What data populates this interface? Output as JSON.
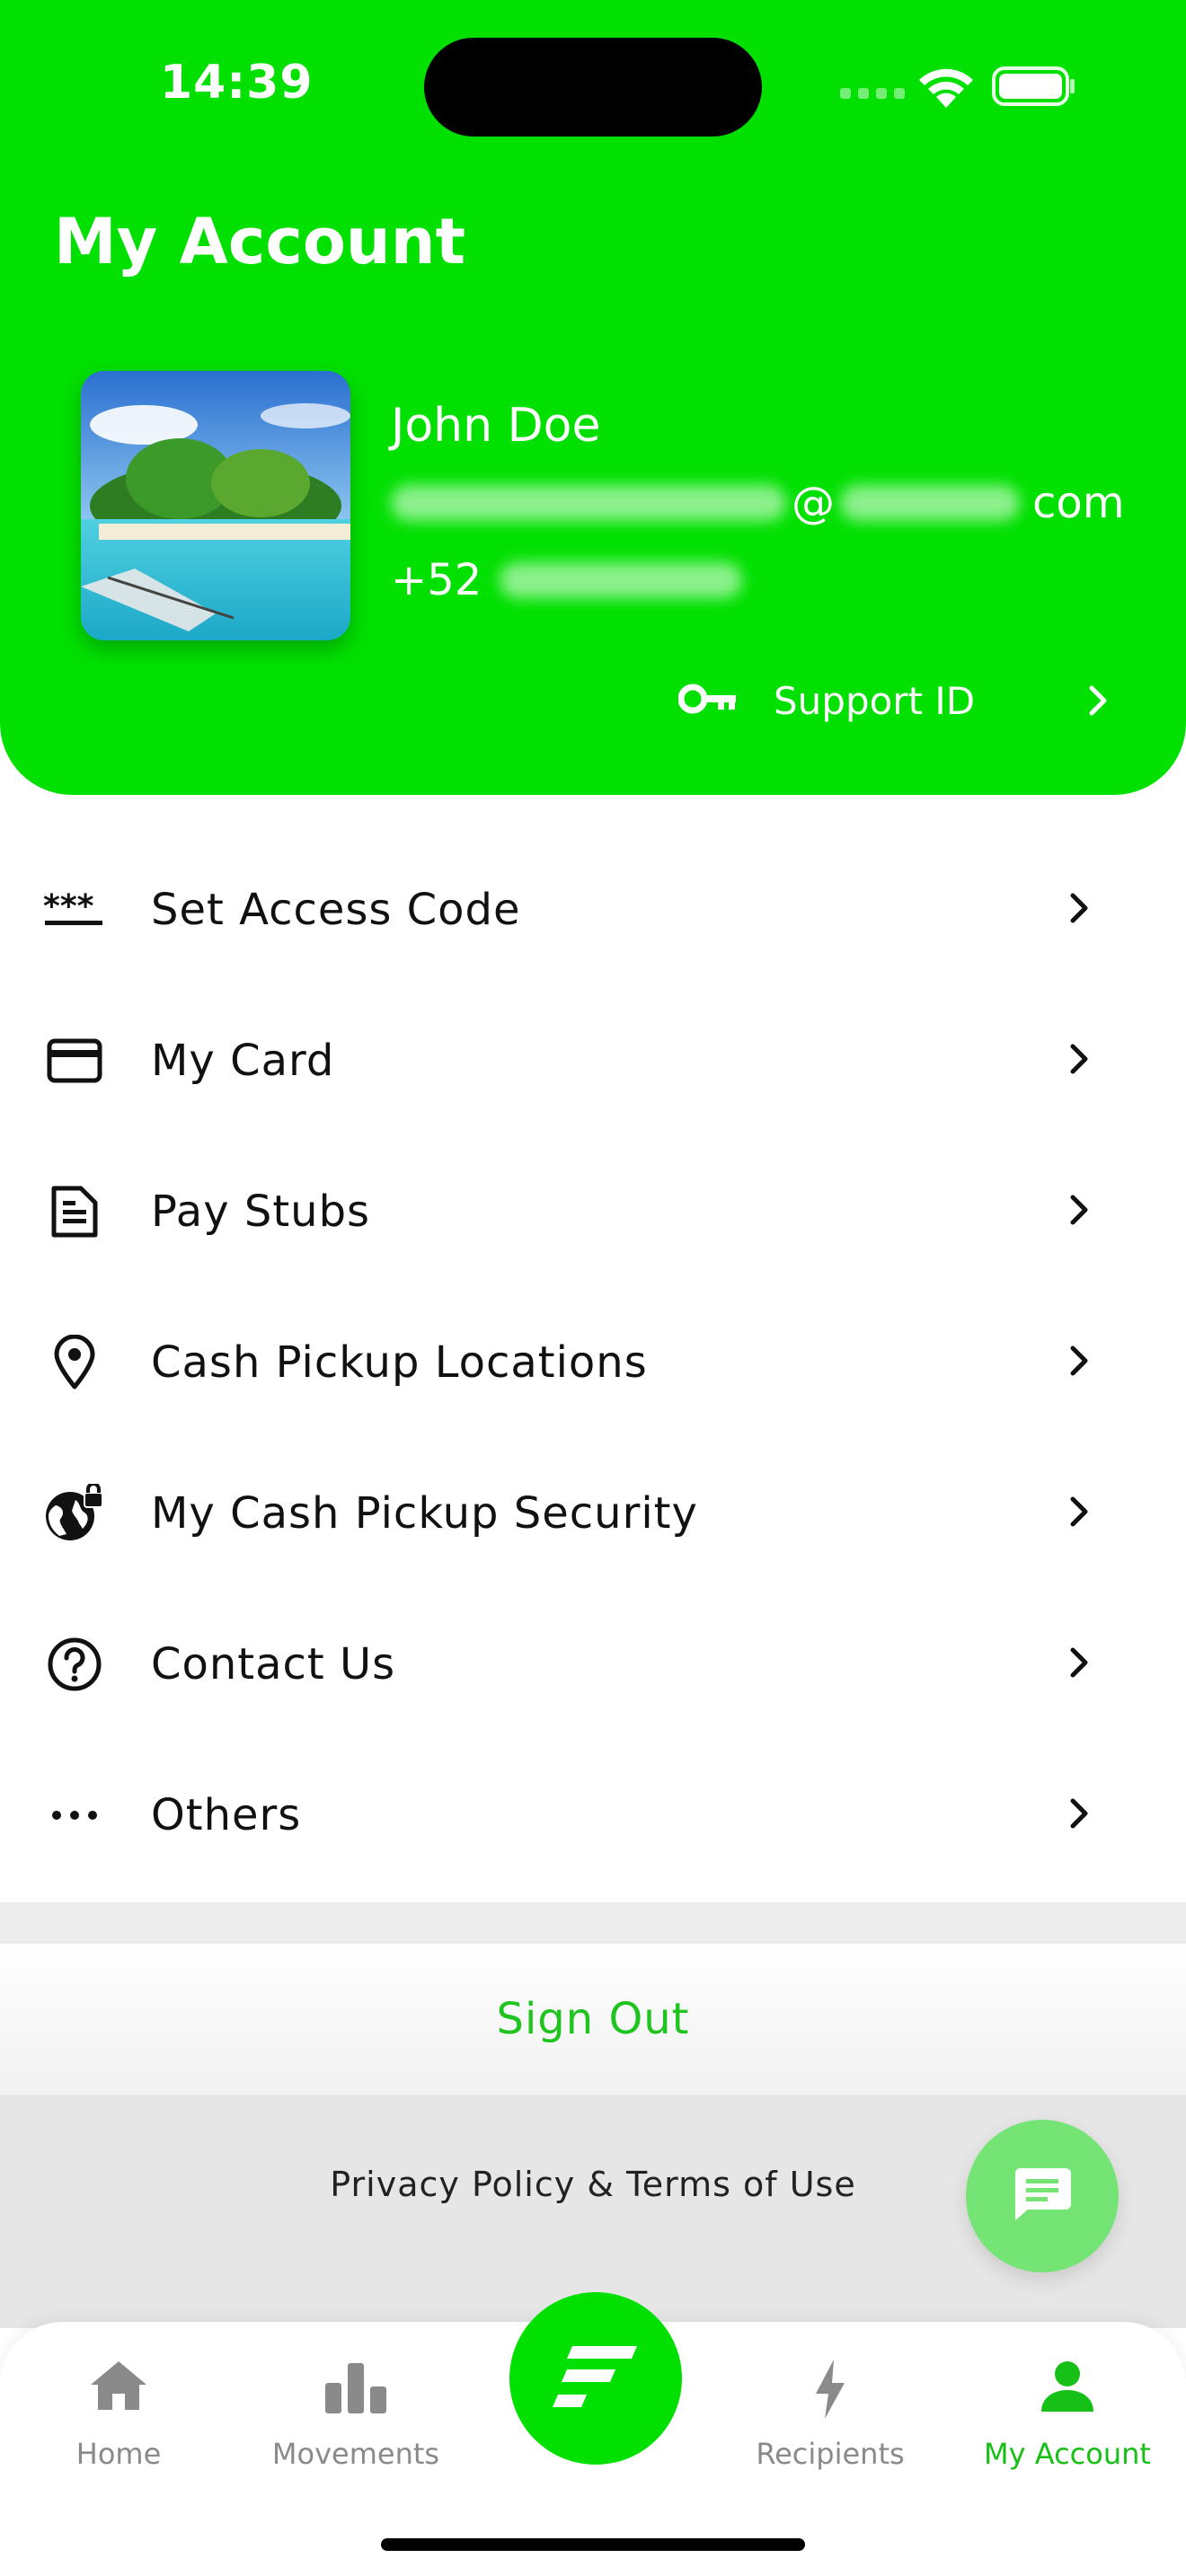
{
  "status_bar": {
    "time": "14:39"
  },
  "header": {
    "title": "My Account",
    "profile": {
      "name": "John Doe",
      "email_visible_at": "@",
      "email_visible_tail": "com",
      "phone_prefix": "+52"
    },
    "support": {
      "label": "Support ID",
      "icon": "key-icon"
    }
  },
  "menu": {
    "items": [
      {
        "label": "Set Access Code",
        "icon": "asterisks-icon"
      },
      {
        "label": "My Card",
        "icon": "credit-card-icon"
      },
      {
        "label": "Pay Stubs",
        "icon": "document-icon"
      },
      {
        "label": "Cash Pickup Locations",
        "icon": "location-pin-icon"
      },
      {
        "label": "My Cash Pickup Security",
        "icon": "globe-lock-icon"
      },
      {
        "label": "Contact Us",
        "icon": "help-circle-icon"
      },
      {
        "label": "Others",
        "icon": "more-dots-icon"
      }
    ]
  },
  "sign_out": {
    "label": "Sign Out"
  },
  "footer": {
    "privacy_label": "Privacy Policy & Terms of Use"
  },
  "bottom_nav": {
    "items": [
      {
        "label": "Home",
        "icon": "home-icon",
        "active": false
      },
      {
        "label": "Movements",
        "icon": "bar-chart-icon",
        "active": false
      },
      {
        "label": "Recipients",
        "icon": "lightning-icon",
        "active": false
      },
      {
        "label": "My Account",
        "icon": "person-icon",
        "active": true
      }
    ]
  },
  "colors": {
    "brand_green": "#02e002",
    "active_green": "#17c017",
    "chat_fab": "#74e474",
    "inactive_nav": "#8a8a8a"
  }
}
